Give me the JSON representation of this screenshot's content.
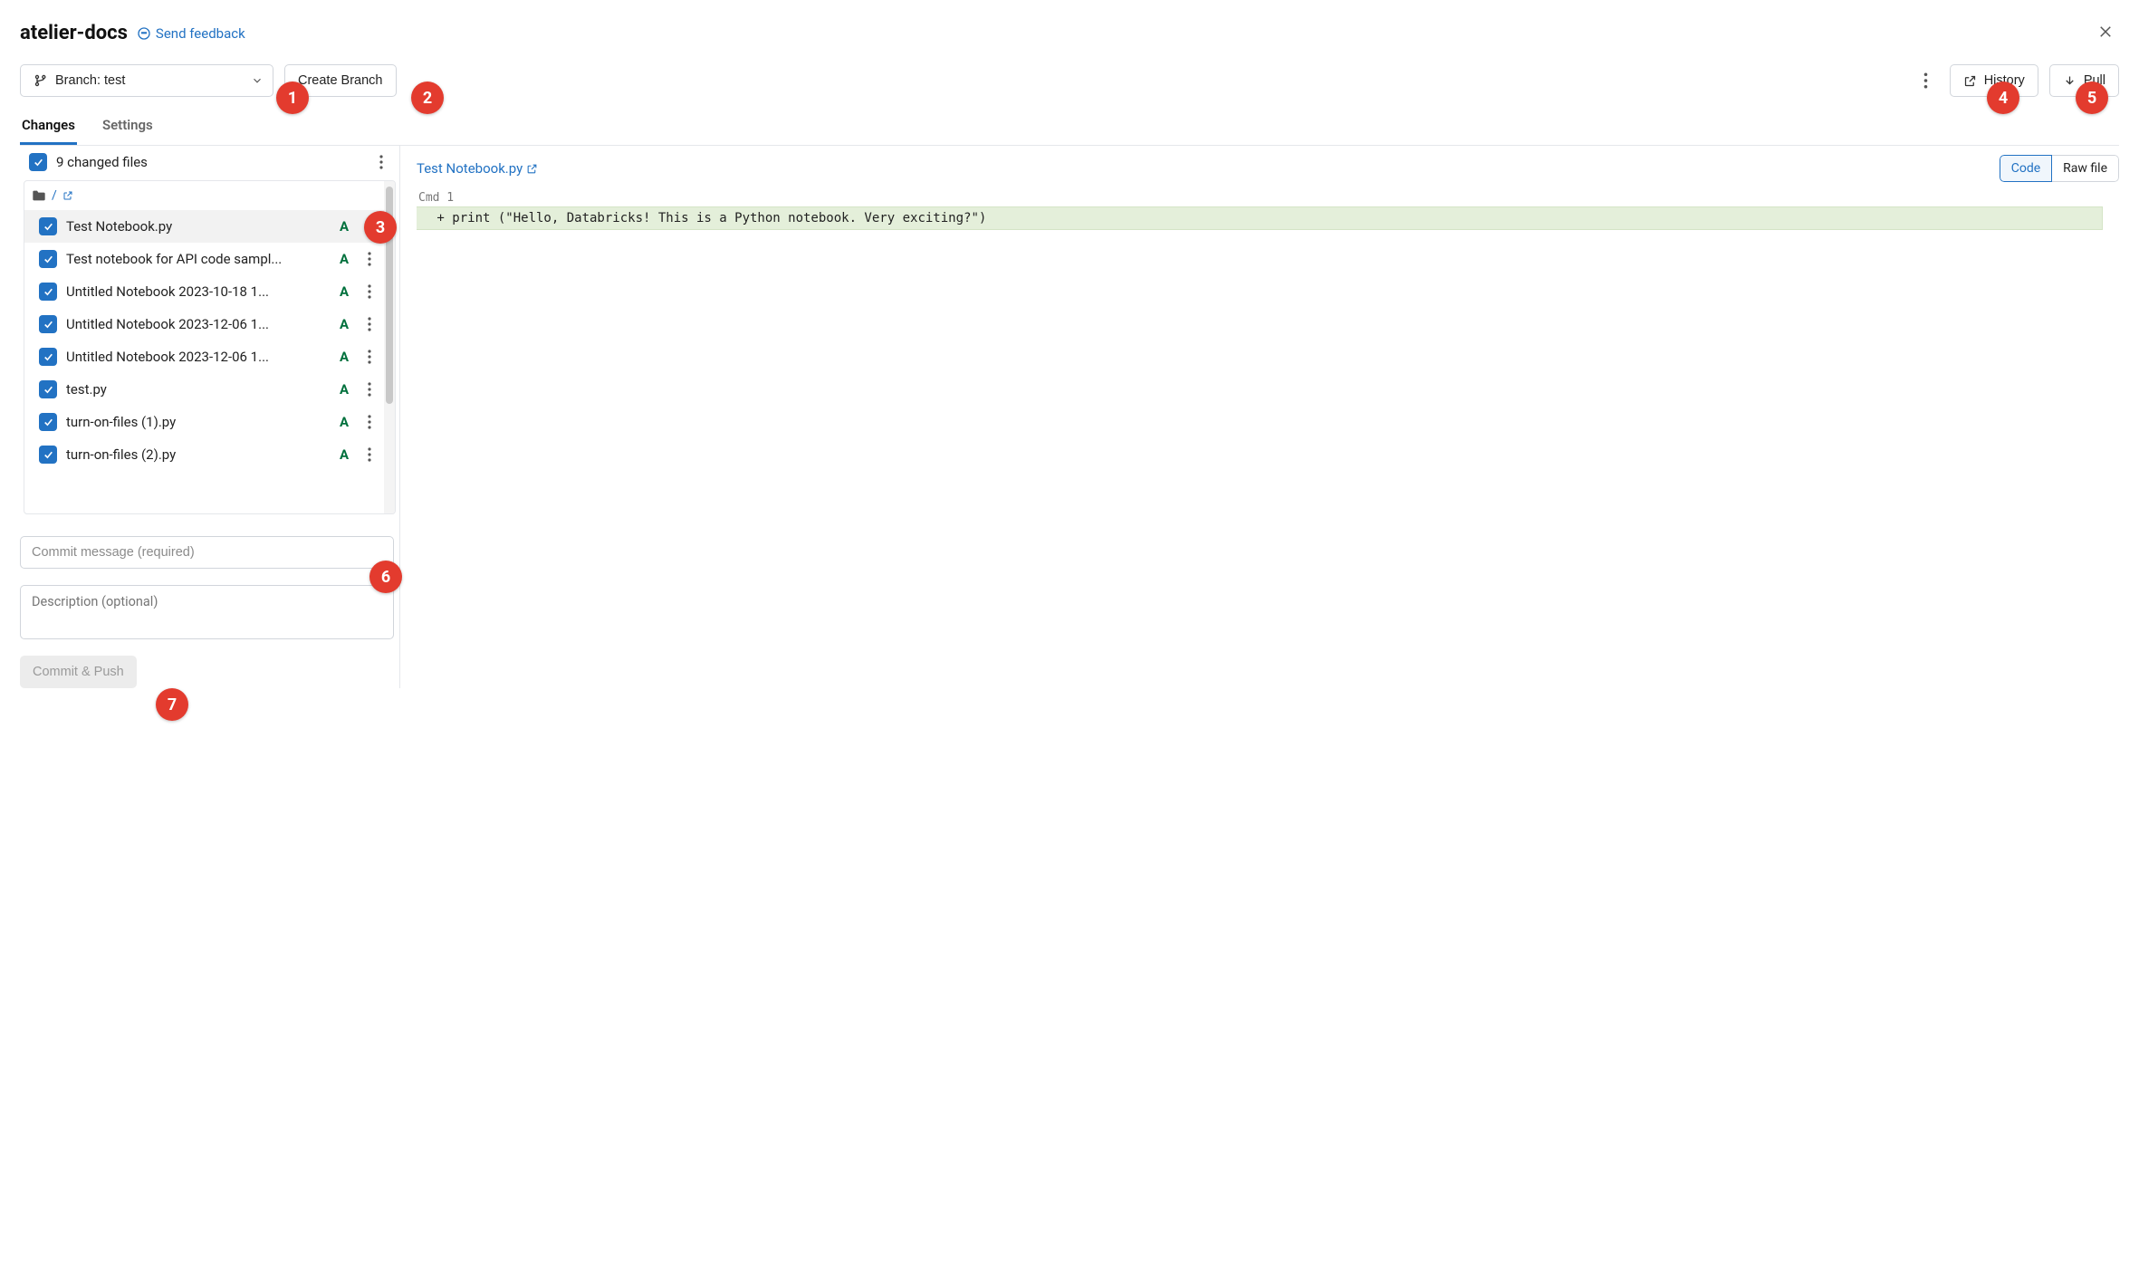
{
  "header": {
    "title": "atelier-docs",
    "feedback_label": "Send feedback"
  },
  "toolbar": {
    "branch_label": "Branch: test",
    "create_branch_label": "Create Branch",
    "history_label": "History",
    "pull_label": "Pull"
  },
  "tabs": {
    "changes_label": "Changes",
    "settings_label": "Settings"
  },
  "files": {
    "summary": "9 changed files",
    "root_label": "/",
    "items": [
      {
        "name": "Test Notebook.py",
        "status": "A",
        "selected": true
      },
      {
        "name": "Test notebook for API code sampl...",
        "status": "A"
      },
      {
        "name": "Untitled Notebook 2023-10-18 1...",
        "status": "A"
      },
      {
        "name": "Untitled Notebook 2023-12-06 1...",
        "status": "A"
      },
      {
        "name": "Untitled Notebook 2023-12-06 1...",
        "status": "A"
      },
      {
        "name": "test.py",
        "status": "A"
      },
      {
        "name": "turn-on-files (1).py",
        "status": "A"
      },
      {
        "name": "turn-on-files (2).py",
        "status": "A"
      }
    ]
  },
  "commit": {
    "message_placeholder": "Commit message (required)",
    "description_placeholder": "Description (optional)",
    "button_label": "Commit & Push"
  },
  "diff": {
    "file_name": "Test Notebook.py",
    "view_code": "Code",
    "view_raw": "Raw file",
    "cmd_label": "Cmd 1",
    "diff_line": " + print (\"Hello, Databricks! This is a Python notebook. Very exciting?\")"
  },
  "callouts": {
    "c1": "1",
    "c2": "2",
    "c3": "3",
    "c4": "4",
    "c5": "5",
    "c6": "6",
    "c7": "7"
  }
}
